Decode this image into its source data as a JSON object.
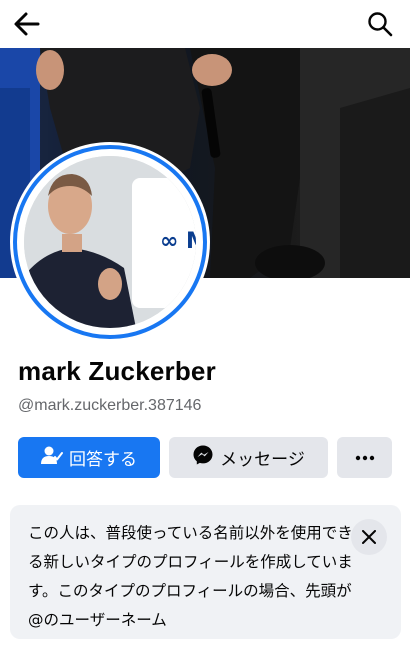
{
  "header": {
    "back_icon": "arrow-left-icon",
    "search_icon": "search-icon"
  },
  "cover": {
    "description_icon": "cover-photo"
  },
  "profile": {
    "name": "mark Zuckerber",
    "handle": "@mark.zuckerber.387146",
    "avatar_logo_text": "∞ M"
  },
  "actions": {
    "answer_label": "回答する",
    "message_label": "メッセージ",
    "more_icon": "more-horizontal-icon"
  },
  "notice": {
    "text": "この人は、普段使っている名前以外を使用できる新しいタイプのプロフィールを作成しています。このタイプのプロフィールの場合、先頭が@のユーザーネーム",
    "close_icon": "close-icon"
  },
  "colors": {
    "accent": "#1877f2",
    "secondary_button": "#e4e6eb",
    "notice_bg": "#f0f2f5"
  }
}
